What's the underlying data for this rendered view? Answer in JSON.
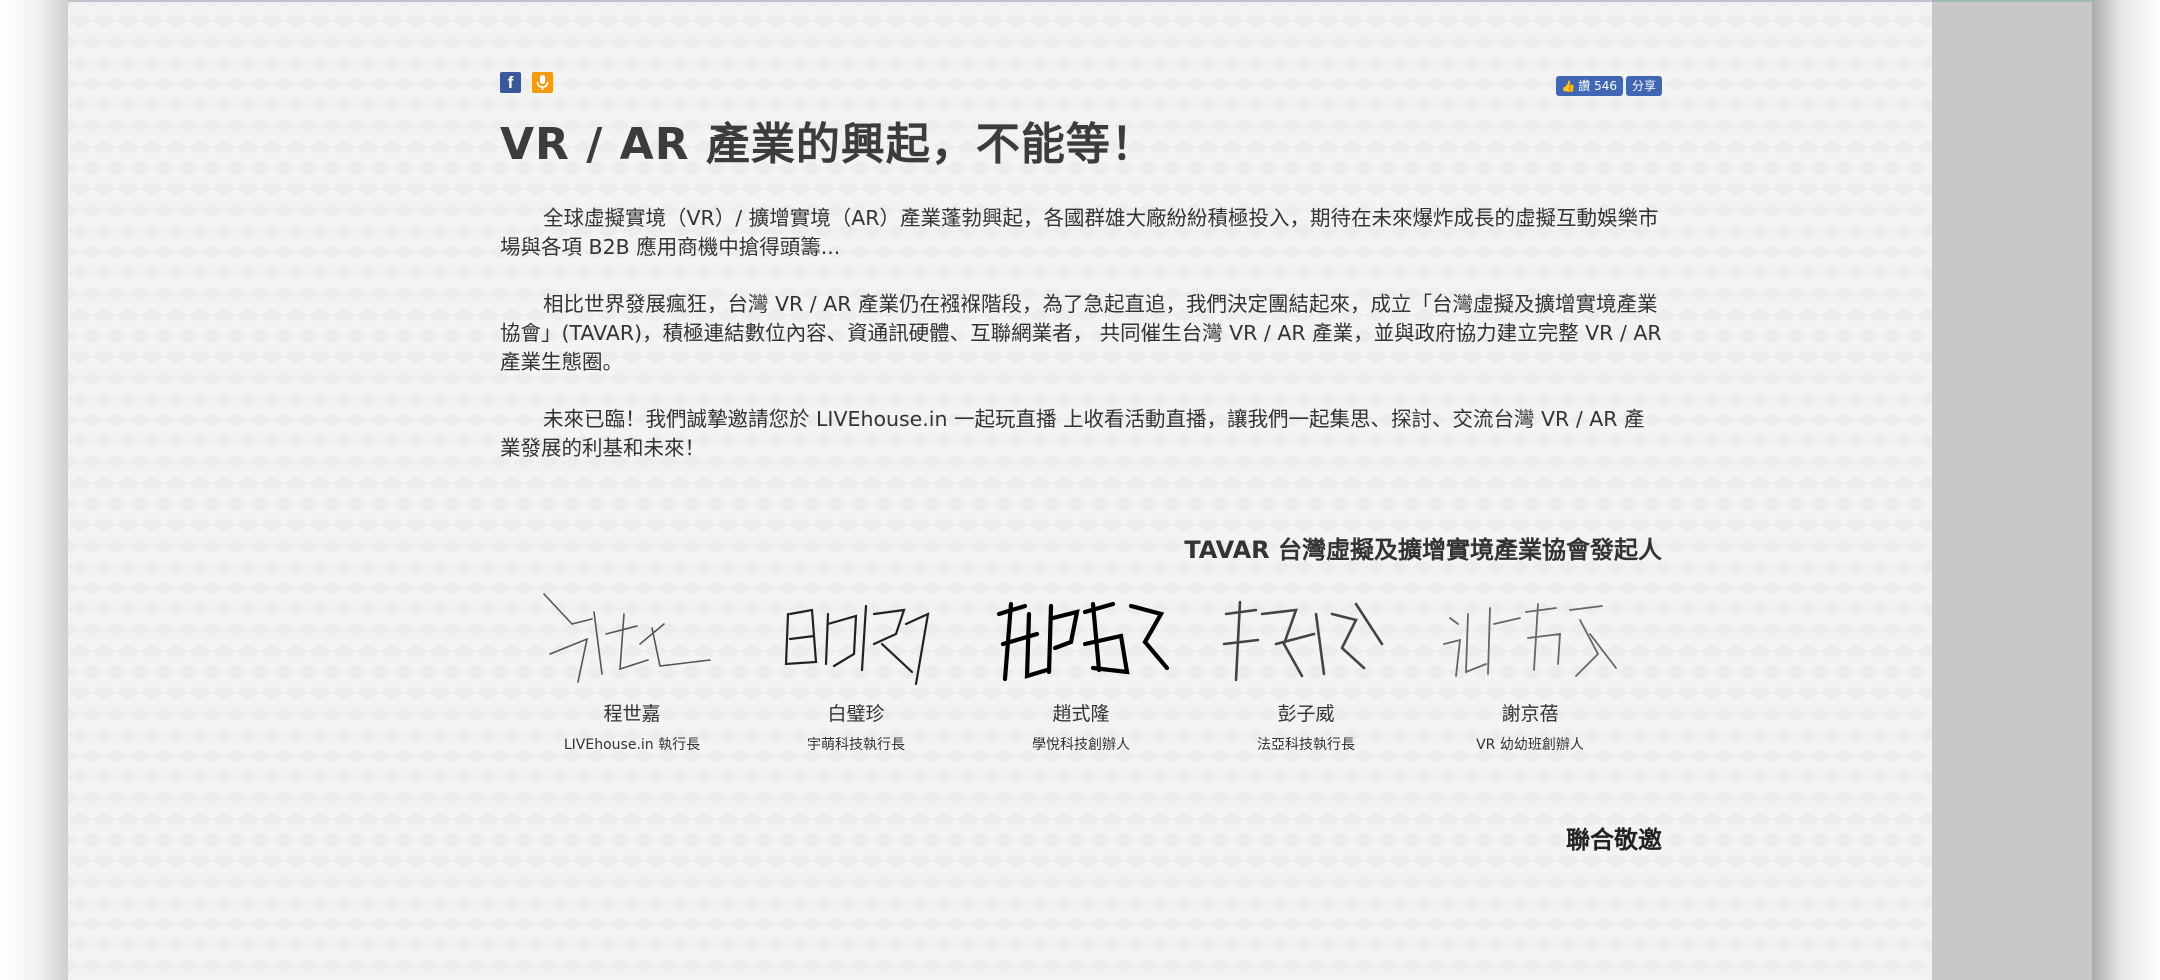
{
  "share": {
    "facebook_icon": "f",
    "mic_icon": "🎙"
  },
  "fb_widget": {
    "like_label": "讚",
    "like_count": "546",
    "share_label": "分享"
  },
  "article": {
    "title": "VR / AR 產業的興起，不能等！",
    "paragraphs": [
      "全球虛擬實境（VR）/ 擴增實境（AR）產業蓬勃興起，各國群雄大廠紛紛積極投入，期待在未來爆炸成長的虛擬互動娛樂市場與各項 B2B 應用商機中搶得頭籌...",
      "相比世界發展瘋狂，台灣 VR / AR 產業仍在襁褓階段，為了急起直追，我們決定團結起來，成立「台灣虛擬及擴增實境產業協會」(TAVAR)，積極連結數位內容、資通訊硬體、互聯網業者， 共同催生台灣 VR / AR 產業，並與政府協力建立完整 VR / AR 產業生態圈。",
      "未來已臨！我們誠摯邀請您於 LIVEhouse.in 一起玩直播 上收看活動直播，讓我們一起集思、探討、交流台灣 VR / AR 產業發展的利基和未來！"
    ]
  },
  "founders": {
    "heading": "TAVAR 台灣虛擬及擴增實境產業協會發起人",
    "people": [
      {
        "name": "程世嘉",
        "title": "LIVEhouse.in 執行長"
      },
      {
        "name": "白璧珍",
        "title": "宇萌科技執行長"
      },
      {
        "name": "趙式隆",
        "title": "學悅科技創辦人"
      },
      {
        "name": "彭子威",
        "title": "法亞科技執行長"
      },
      {
        "name": "謝京蓓",
        "title": "VR 幼幼班創辦人"
      }
    ]
  },
  "closing": {
    "invite": "聯合敬邀"
  }
}
